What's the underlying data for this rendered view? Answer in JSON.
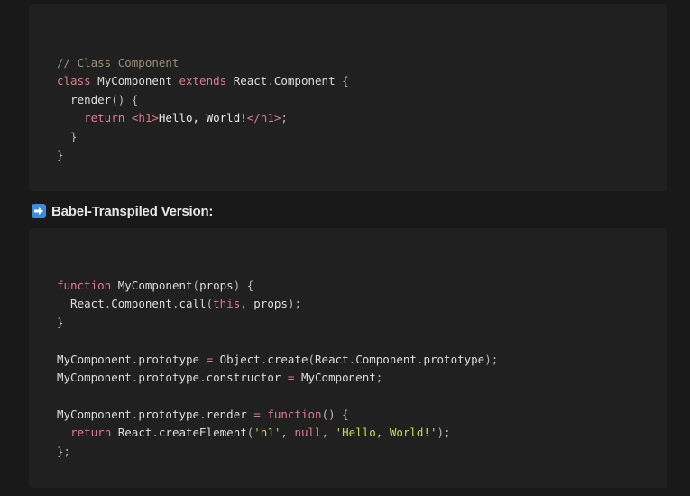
{
  "code_block_1": {
    "lines": [
      [
        {
          "t": "// Class Component",
          "c": "comment"
        }
      ],
      [
        {
          "t": "class",
          "c": "keyword"
        },
        {
          "t": " MyComponent ",
          "c": "ident"
        },
        {
          "t": "extends",
          "c": "keyword"
        },
        {
          "t": " React",
          "c": "ident"
        },
        {
          "t": ".",
          "c": "punc"
        },
        {
          "t": "Component ",
          "c": "ident"
        },
        {
          "t": "{",
          "c": "punc"
        }
      ],
      [
        {
          "t": "  render",
          "c": "ident"
        },
        {
          "t": "() {",
          "c": "punc"
        }
      ],
      [
        {
          "t": "    ",
          "c": "ident"
        },
        {
          "t": "return",
          "c": "keyword"
        },
        {
          "t": " ",
          "c": "ident"
        },
        {
          "t": "<h1>",
          "c": "tag"
        },
        {
          "t": "Hello, World!",
          "c": "text"
        },
        {
          "t": "</h1>",
          "c": "tag"
        },
        {
          "t": ";",
          "c": "punc"
        }
      ],
      [
        {
          "t": "  }",
          "c": "punc"
        }
      ],
      [
        {
          "t": "}",
          "c": "punc"
        }
      ]
    ]
  },
  "section_heading": {
    "icon": "right-arrow-icon",
    "icon_color": "#3a8dde",
    "text": "Babel-Transpiled Version:"
  },
  "code_block_2": {
    "lines": [
      [
        {
          "t": "function",
          "c": "keyword"
        },
        {
          "t": " MyComponent",
          "c": "ident"
        },
        {
          "t": "(",
          "c": "punc"
        },
        {
          "t": "props",
          "c": "ident"
        },
        {
          "t": ") {",
          "c": "punc"
        }
      ],
      [
        {
          "t": "  React",
          "c": "ident"
        },
        {
          "t": ".",
          "c": "punc"
        },
        {
          "t": "Component",
          "c": "ident"
        },
        {
          "t": ".",
          "c": "punc"
        },
        {
          "t": "call",
          "c": "ident"
        },
        {
          "t": "(",
          "c": "punc"
        },
        {
          "t": "this",
          "c": "keyword"
        },
        {
          "t": ", ",
          "c": "punc"
        },
        {
          "t": "props",
          "c": "ident"
        },
        {
          "t": ");",
          "c": "punc"
        }
      ],
      [
        {
          "t": "}",
          "c": "punc"
        }
      ],
      [],
      [
        {
          "t": "MyComponent",
          "c": "ident"
        },
        {
          "t": ".",
          "c": "punc"
        },
        {
          "t": "prototype ",
          "c": "ident"
        },
        {
          "t": "=",
          "c": "keyword"
        },
        {
          "t": " Object",
          "c": "ident"
        },
        {
          "t": ".",
          "c": "punc"
        },
        {
          "t": "create",
          "c": "ident"
        },
        {
          "t": "(",
          "c": "punc"
        },
        {
          "t": "React",
          "c": "ident"
        },
        {
          "t": ".",
          "c": "punc"
        },
        {
          "t": "Component",
          "c": "ident"
        },
        {
          "t": ".",
          "c": "punc"
        },
        {
          "t": "prototype",
          "c": "ident"
        },
        {
          "t": ");",
          "c": "punc"
        }
      ],
      [
        {
          "t": "MyComponent",
          "c": "ident"
        },
        {
          "t": ".",
          "c": "punc"
        },
        {
          "t": "prototype",
          "c": "ident"
        },
        {
          "t": ".",
          "c": "punc"
        },
        {
          "t": "constructor ",
          "c": "ident"
        },
        {
          "t": "=",
          "c": "keyword"
        },
        {
          "t": " MyComponent",
          "c": "ident"
        },
        {
          "t": ";",
          "c": "punc"
        }
      ],
      [],
      [
        {
          "t": "MyComponent",
          "c": "ident"
        },
        {
          "t": ".",
          "c": "punc"
        },
        {
          "t": "prototype",
          "c": "ident"
        },
        {
          "t": ".",
          "c": "punc"
        },
        {
          "t": "render ",
          "c": "ident"
        },
        {
          "t": "=",
          "c": "keyword"
        },
        {
          "t": " ",
          "c": "ident"
        },
        {
          "t": "function",
          "c": "keyword"
        },
        {
          "t": "() {",
          "c": "punc"
        }
      ],
      [
        {
          "t": "  ",
          "c": "ident"
        },
        {
          "t": "return",
          "c": "keyword"
        },
        {
          "t": " React",
          "c": "ident"
        },
        {
          "t": ".",
          "c": "punc"
        },
        {
          "t": "createElement",
          "c": "ident"
        },
        {
          "t": "(",
          "c": "punc"
        },
        {
          "t": "'h1'",
          "c": "string"
        },
        {
          "t": ", ",
          "c": "punc"
        },
        {
          "t": "null",
          "c": "keyword"
        },
        {
          "t": ", ",
          "c": "punc"
        },
        {
          "t": "'Hello, World!'",
          "c": "string"
        },
        {
          "t": ");",
          "c": "punc"
        }
      ],
      [
        {
          "t": "};",
          "c": "punc"
        }
      ]
    ]
  }
}
